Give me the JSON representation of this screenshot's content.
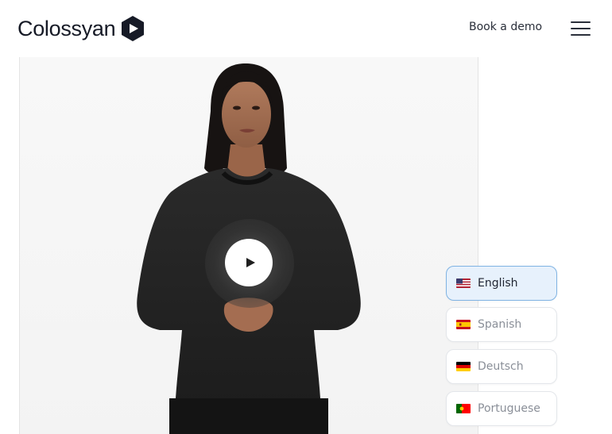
{
  "header": {
    "logo_text": "Colossyan",
    "book_demo_label": "Book a demo",
    "menu_icon": "hamburger-menu-icon"
  },
  "video": {
    "play_icon": "play-icon",
    "state": "paused"
  },
  "languages": {
    "selected": "English",
    "items": [
      {
        "label": "English",
        "flag": "us-flag-icon",
        "active": true
      },
      {
        "label": "Spanish",
        "flag": "spain-flag-icon",
        "active": false
      },
      {
        "label": "Deutsch",
        "flag": "germany-flag-icon",
        "active": false
      },
      {
        "label": "Portuguese",
        "flag": "portugal-flag-icon",
        "active": false
      }
    ]
  },
  "colors": {
    "active_bg": "#e7f1fc",
    "active_border": "#7fb3e3",
    "logo_mark": "#161a26"
  }
}
